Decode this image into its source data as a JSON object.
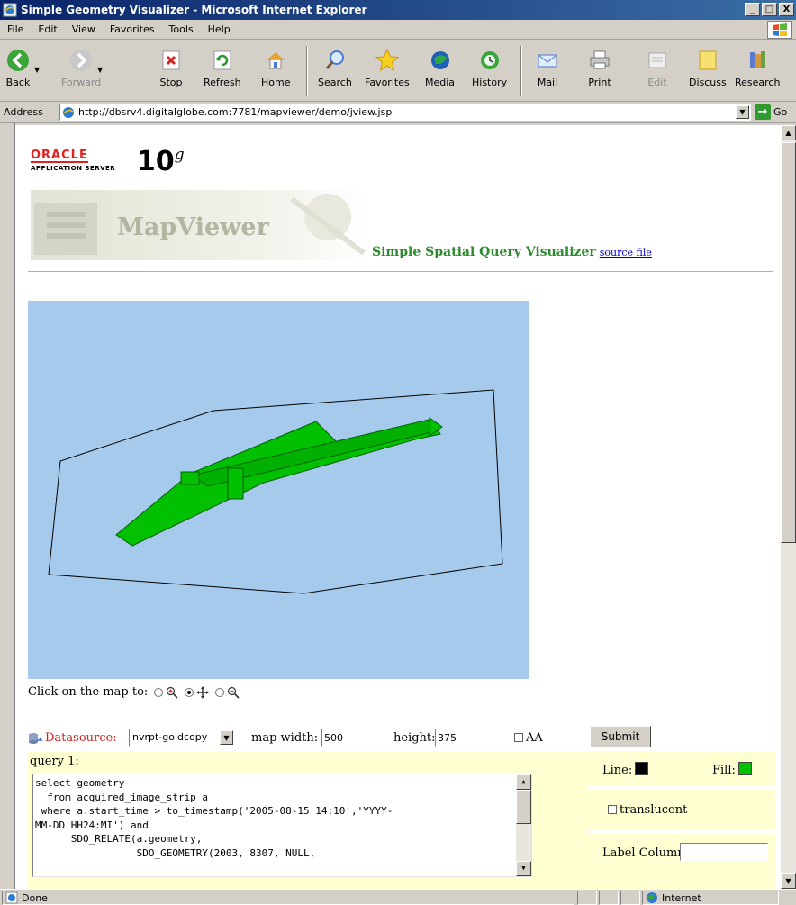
{
  "window": {
    "title": "Simple Geometry Visualizer - Microsoft Internet Explorer",
    "min": "_",
    "max": "□",
    "close": "X"
  },
  "menu": [
    "File",
    "Edit",
    "View",
    "Favorites",
    "Tools",
    "Help"
  ],
  "toolbar": {
    "back": "Back",
    "forward": "Forward",
    "stop": "Stop",
    "refresh": "Refresh",
    "home": "Home",
    "search": "Search",
    "favorites": "Favorites",
    "media": "Media",
    "history": "History",
    "mail": "Mail",
    "print": "Print",
    "edit": "Edit",
    "discuss": "Discuss",
    "research": "Research"
  },
  "address": {
    "label": "Address",
    "url": "http://dbsrv4.digitalglobe.com:7781/mapviewer/demo/jview.jsp",
    "go": "Go"
  },
  "page": {
    "oracle": "ORACLE",
    "appserver": "APPLICATION SERVER",
    "version": "10",
    "version_suffix": "g",
    "banner": "MapViewer",
    "title": "Simple Spatial Query Visualizer",
    "source_link": "source file",
    "click_label": "Click on the map to:",
    "datasource_label": "Datasource:",
    "datasource_value": "nvrpt-goldcopy",
    "map_width_label": "map width:",
    "map_width_value": "500",
    "height_label": "height:",
    "height_value": "375",
    "aa_label": "AA",
    "submit": "Submit",
    "query_label": "query 1:",
    "query_text": "select geometry\n  from acquired_image_strip a\n where a.start_time > to_timestamp('2005-08-15 14:10','YYYY-\nMM-DD HH24:MI') and\n      SDO_RELATE(a.geometry,\n                 SDO_GEOMETRY(2003, 8307, NULL,",
    "line_label": "Line:",
    "fill_label": "Fill:",
    "translucent_label": "translucent",
    "label_column_label": "Label Column:",
    "label_column_value": ""
  },
  "colors": {
    "line": "#000000",
    "fill": "#00c000",
    "map_bg": "#a6caec",
    "title_green": "#2e8b2e"
  },
  "status": {
    "text": "Done",
    "zone": "Internet"
  }
}
